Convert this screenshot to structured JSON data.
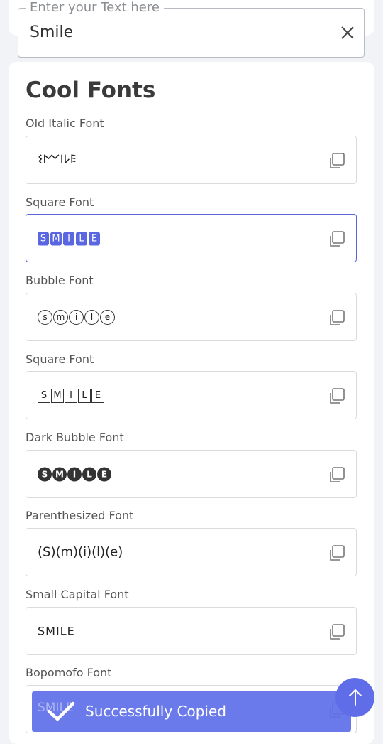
{
  "search": {
    "label": "Enter your Text here",
    "value": "Smile"
  },
  "section": {
    "title": "Cool Fonts"
  },
  "fonts": [
    {
      "label": "Old Italic Font",
      "output": "𐌔𐌌𐌉𐌋𐌄"
    },
    {
      "label": "Square Font",
      "letters": [
        "S",
        "M",
        "I",
        "L",
        "E"
      ]
    },
    {
      "label": "Bubble Font",
      "letters": [
        "s",
        "m",
        "i",
        "l",
        "e"
      ]
    },
    {
      "label": "Square Font",
      "letters": [
        "S",
        "M",
        "I",
        "L",
        "E"
      ]
    },
    {
      "label": "Dark Bubble Font",
      "letters": [
        "S",
        "M",
        "I",
        "L",
        "E"
      ]
    },
    {
      "label": "Parenthesized Font",
      "output": "(S)(m)(i)(l)(e)"
    },
    {
      "label": "Small Capital Font",
      "output": "SMILE"
    },
    {
      "label": "Bopomofo Font",
      "output": "SMILE"
    }
  ],
  "toast": {
    "message": "Successfully Copied"
  },
  "colors": {
    "accent": "#5b67e0",
    "toast": "#6070e8",
    "scroll_button": "#5f6ee8"
  },
  "icons": {
    "clear": "close-icon",
    "copy": "copy-icon",
    "scroll": "arrow-up-icon",
    "toast": "check-icon"
  }
}
